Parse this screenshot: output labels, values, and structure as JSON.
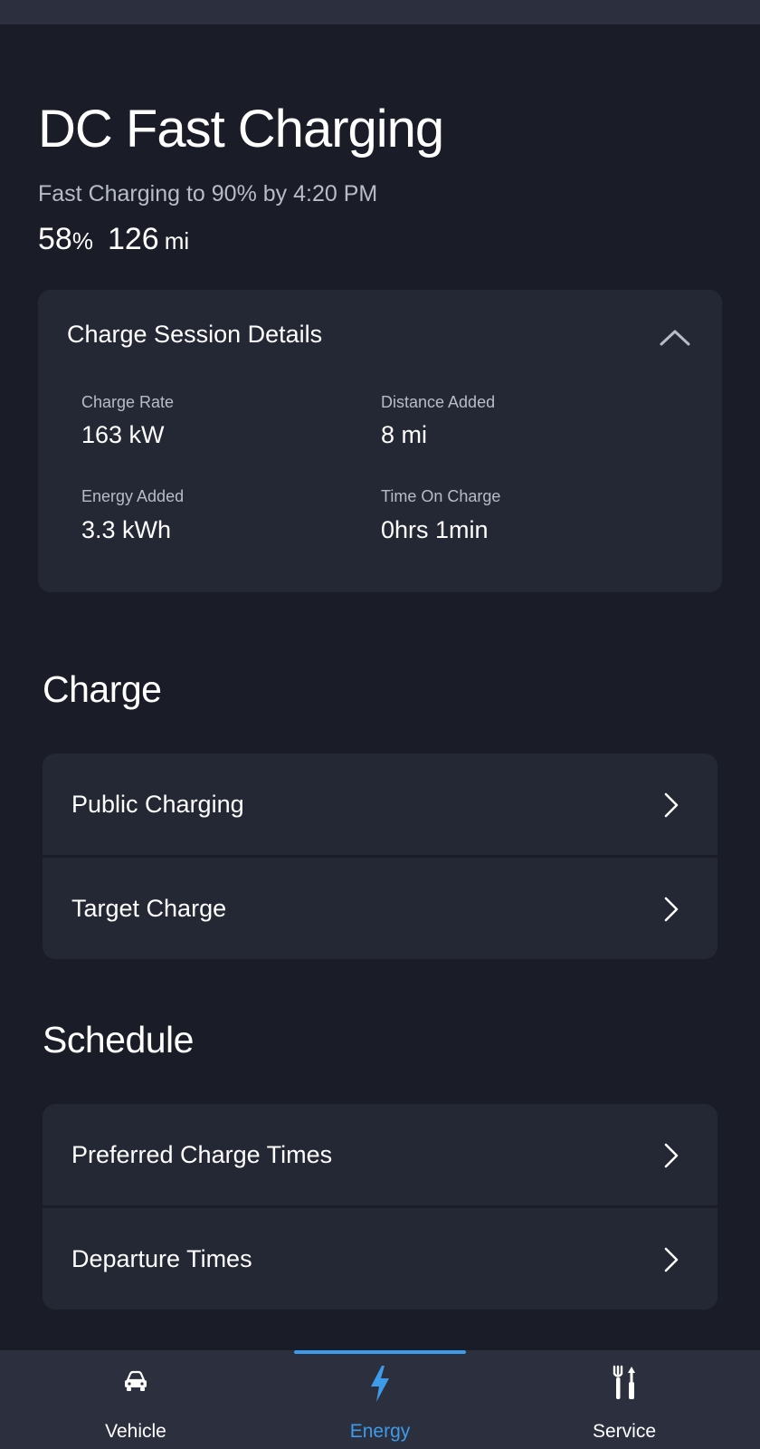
{
  "colors": {
    "background": "#1a1d27",
    "card": "#242835",
    "nav_background": "#2c303e",
    "accent": "#3d9be9",
    "muted_text": "#b8bcc8"
  },
  "header": {
    "title": "DC Fast Charging",
    "subtitle": "Fast Charging to 90% by 4:20 PM",
    "battery_percent_value": "58",
    "battery_percent_unit": "%",
    "range_value": "126",
    "range_unit": "mi"
  },
  "session_details": {
    "title": "Charge Session Details",
    "toggle_icon": "chevron-up-icon",
    "stats": {
      "charge_rate": {
        "label": "Charge Rate",
        "value": "163 kW"
      },
      "distance_added": {
        "label": "Distance Added",
        "value": "8 mi"
      },
      "energy_added": {
        "label": "Energy Added",
        "value": "3.3 kWh"
      },
      "time_on_charge": {
        "label": "Time On Charge",
        "value": "0hrs 1min"
      }
    }
  },
  "charge_section": {
    "title": "Charge",
    "items": [
      {
        "label": "Public Charging",
        "icon": "chevron-right-icon"
      },
      {
        "label": "Target Charge",
        "icon": "chevron-right-icon"
      }
    ]
  },
  "schedule_section": {
    "title": "Schedule",
    "items": [
      {
        "label": "Preferred Charge Times",
        "icon": "chevron-right-icon"
      },
      {
        "label": "Departure Times",
        "icon": "chevron-right-icon"
      }
    ]
  },
  "bottom_nav": {
    "items": [
      {
        "label": "Vehicle",
        "icon": "car-icon",
        "active": false
      },
      {
        "label": "Energy",
        "icon": "lightning-bolt-icon",
        "active": true
      },
      {
        "label": "Service",
        "icon": "tools-icon",
        "active": false
      }
    ]
  }
}
